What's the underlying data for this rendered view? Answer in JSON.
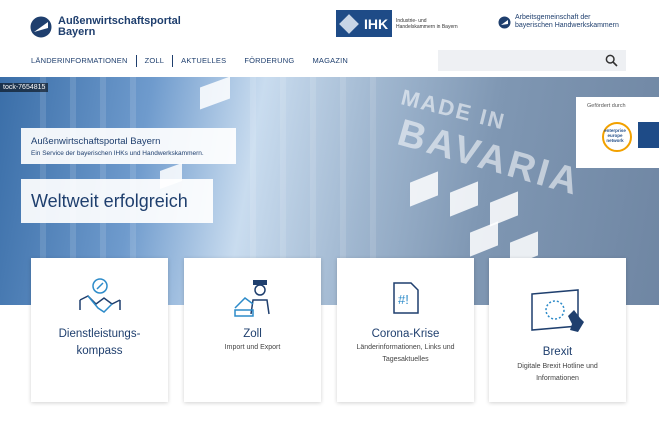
{
  "header": {
    "logo_line1": "Außenwirtschaftsportal",
    "logo_line2": "Bayern",
    "ihk_label": "IHK",
    "ihk_sub": "Industrie- und Handelskammern in Bayern",
    "arge_line1": "Arbeitsgemeinschaft der",
    "arge_line2": "bayerischen Handwerkskammern"
  },
  "nav": {
    "items": [
      "LÄNDERINFORMATIONEN",
      "ZOLL",
      "AKTUELLES",
      "FÖRDERUNG",
      "MAGAZIN"
    ]
  },
  "search": {
    "placeholder": ""
  },
  "hero": {
    "credit": "tock-7654815",
    "intro_title": "Außenwirtschaftsportal Bayern",
    "intro_sub": "Ein Service der bayerischen IHKs und Handwerkskammern.",
    "claim": "Weltweit erfolgreich",
    "container_text1": "MADE IN",
    "container_text2": "BAVARIA",
    "funded_label": "Gefördert durch",
    "een_text": "enterprise europe network"
  },
  "cards": [
    {
      "title": "Dienstleistungs-",
      "title2": "kompass",
      "sub": "",
      "sub2": "",
      "icon": "handshake-compass-icon"
    },
    {
      "title": "Zoll",
      "title2": "",
      "sub": "Import und Export",
      "sub2": "",
      "icon": "customs-officer-icon"
    },
    {
      "title": "Corona-Krise",
      "title2": "",
      "sub": "Länderinformationen, Links und",
      "sub2": "Tagesaktuelles",
      "icon": "hashtag-document-icon"
    },
    {
      "title": "Brexit",
      "title2": "",
      "sub": "Digitale Brexit Hotline und",
      "sub2": "Informationen",
      "icon": "eu-uk-flag-icon"
    }
  ],
  "colors": {
    "brand": "#1f3f6e",
    "ihk_blue": "#1e4b87",
    "icon_blue": "#2d8bc9"
  }
}
